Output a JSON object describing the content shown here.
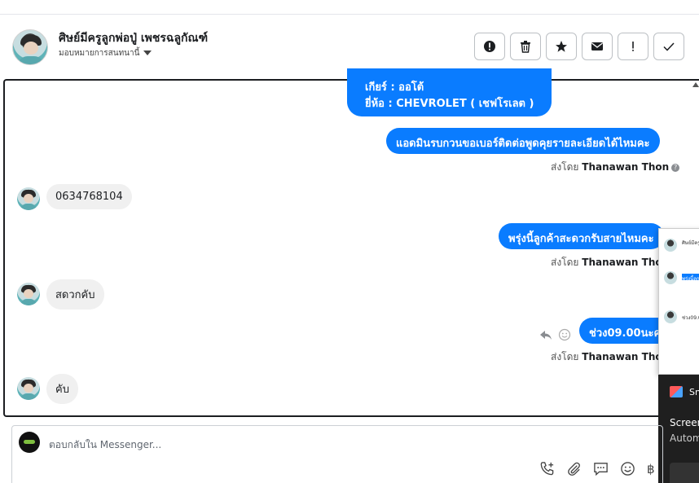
{
  "header": {
    "name": "ศิษย์มีครูลูกพ่อปู่ เพชรฉลูกัณฑ์",
    "subtitle": "มอบหมายการสนทนานี้"
  },
  "toolbar": {
    "buttons": [
      {
        "icon": "exclamation-circle-icon"
      },
      {
        "icon": "trash-icon"
      },
      {
        "icon": "star-icon"
      },
      {
        "icon": "envelope-icon"
      },
      {
        "icon": "exclamation-icon"
      },
      {
        "icon": "checkmark-icon"
      }
    ]
  },
  "messages": {
    "m1_line1": "เกียร์ : ออโต้",
    "m1_line2": "ยี่ห้อ : CHEVROLET ( เชฟโรเลต )",
    "m2": "แอดมินรบกวนขอเบอร์ติดต่อพูดคุยรายละเอียดได้ไหมคะ",
    "sent_prefix": "ส่งโดย",
    "sender": "Thanawan Thon",
    "m3": "0634768104",
    "m4": "พรุ่งนี้ลูกค้าสะดวกรับสายไหมคะ",
    "m5": "สดวกคับ",
    "m6": "ช่วง09.00นะคะ",
    "m7": "คับ"
  },
  "popup": {
    "row1": "ศิษย์มีครู มอบหม",
    "row2": "พรุ่งนี้ลูกค้า",
    "row3": "ช่วง09.00"
  },
  "toast": {
    "app": "Sn",
    "line1": "Screen",
    "line2": "Autom"
  },
  "composer": {
    "placeholder": "ตอบกลับใน Messenger...",
    "currency": "฿"
  },
  "colors": {
    "accent": "#0a7cff",
    "incoming_bubble": "#f0f0f0"
  }
}
